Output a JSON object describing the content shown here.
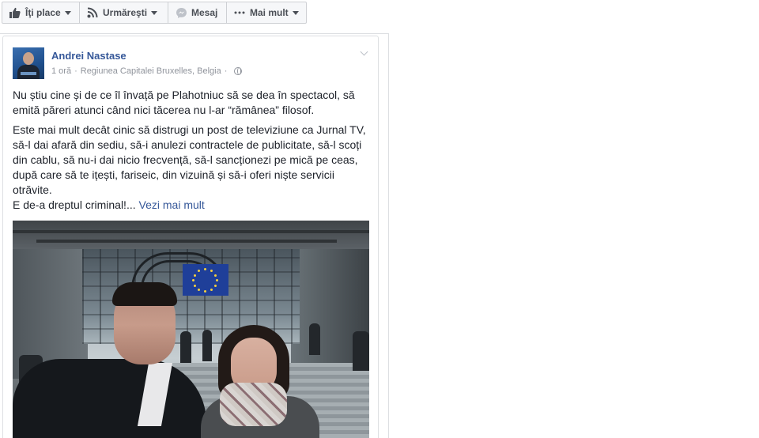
{
  "actions": {
    "like_label": "Îţi place",
    "follow_label": "Urmăreşti",
    "message_label": "Mesaj",
    "more_label": "Mai mult",
    "like_icon": "thumbs-up-icon",
    "follow_icon": "rss-icon",
    "message_icon": "messenger-icon",
    "more_icon": "ellipsis-icon"
  },
  "post": {
    "author": "Andrei Nastase",
    "time": "1 oră",
    "location": "Regiunea Capitalei Bruxelles, Belgia",
    "privacy_icon": "globe-icon",
    "paragraph1": "Nu știu cine și de ce îl învață pe Plahotniuc să se dea în spectacol, să emită păreri atunci când nici tăcerea nu l-ar “rămânea” filosof.",
    "paragraph2": "Este mai mult decât cinic să distrugi un post de televiziune ca Jurnal TV, să-l dai afară din sediu, să-i anulezi contractele de publicitate, să-l scoți din cablu, să nu-i dai nicio frecvență, să-l sancționezi pe mică pe ceas, după care să te ițești, fariseic, din vizuină și să-i oferi niște servicii otrăvite.",
    "paragraph3_lead": "E de-a dreptul criminal!...",
    "see_more": "Vezi mai mult"
  },
  "colors": {
    "link": "#365899",
    "meta": "#90949c",
    "border": "#dddfe2",
    "button_bg": "#f6f7f9"
  }
}
